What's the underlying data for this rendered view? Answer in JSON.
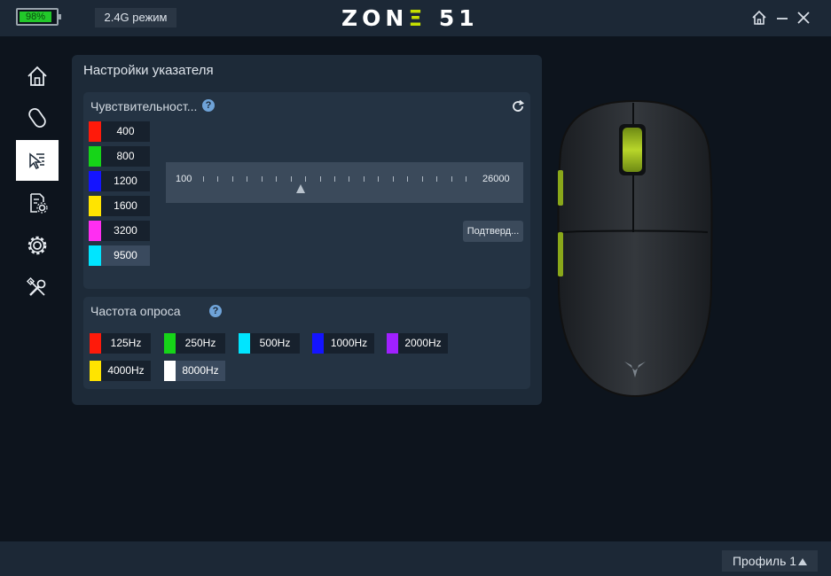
{
  "titlebar": {
    "battery": "98%",
    "mode": "2.4G режим",
    "logo_main": "ZON",
    "logo_accent": "Ξ",
    "logo_tail": " 51"
  },
  "sidebar": {
    "items": [
      {
        "name": "home-icon"
      },
      {
        "name": "mouse-icon"
      },
      {
        "name": "pointer-settings-icon",
        "active": true
      },
      {
        "name": "macro-settings-icon"
      },
      {
        "name": "gear-icon"
      },
      {
        "name": "tools-icon"
      }
    ]
  },
  "panel": {
    "title": "Настройки указателя"
  },
  "sensitivity": {
    "title": "Чувствительност...",
    "help": "?",
    "levels": [
      {
        "value": "400",
        "color": "#ff1a0a"
      },
      {
        "value": "800",
        "color": "#16d418"
      },
      {
        "value": "1200",
        "color": "#1414ff"
      },
      {
        "value": "1600",
        "color": "#ffe400"
      },
      {
        "value": "3200",
        "color": "#ff2ef2"
      },
      {
        "value": "9500",
        "color": "#00e5ff",
        "selected": true
      }
    ],
    "slider": {
      "min": "100",
      "max": "26000",
      "value_fraction": 0.37,
      "ticks": 19
    },
    "confirm": "Подтверд..."
  },
  "polling": {
    "title": "Частота опроса",
    "help": "?",
    "rates": [
      {
        "label": "125Hz",
        "color": "#ff1a0a"
      },
      {
        "label": "250Hz",
        "color": "#16d418"
      },
      {
        "label": "500Hz",
        "color": "#00e5ff"
      },
      {
        "label": "1000Hz",
        "color": "#1414ff"
      },
      {
        "label": "2000Hz",
        "color": "#a020ff"
      },
      {
        "label": "4000Hz",
        "color": "#ffe400"
      },
      {
        "label": "8000Hz",
        "color": "#ffffff",
        "selected": true
      }
    ]
  },
  "footer": {
    "profile": "Профиль 1"
  },
  "colors": {
    "accent": "#c6e000"
  }
}
